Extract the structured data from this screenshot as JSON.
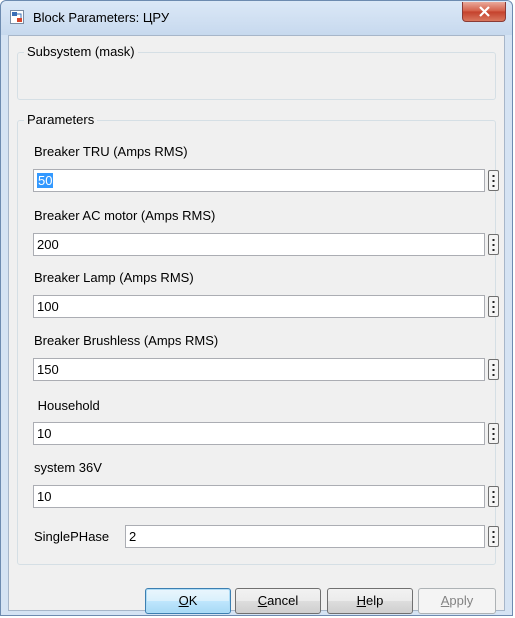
{
  "window": {
    "title": "Block Parameters: ЦРУ",
    "icon": "simulink-block-icon",
    "close_icon": "close-icon"
  },
  "mask_group": {
    "label": "Subsystem (mask)"
  },
  "params_group": {
    "label": "Parameters",
    "fields": [
      {
        "label": "Breaker  TRU (Amps RMS)",
        "value": "50"
      },
      {
        "label": "Breaker AC motor (Amps RMS)",
        "value": "200"
      },
      {
        "label": "Breaker Lamp (Amps RMS)",
        "value": "100"
      },
      {
        "label": "Breaker Brushless (Amps RMS)",
        "value": "150"
      },
      {
        "label": " Household",
        "value": "10"
      },
      {
        "label": "system 36V",
        "value": "10"
      }
    ],
    "inline_field": {
      "label": "SinglePHase",
      "value": "2"
    },
    "menu_icon": "vertical-ellipsis-icon"
  },
  "buttons": {
    "ok": {
      "label": "OK",
      "mnemonic": "O",
      "rest": "K"
    },
    "cancel": {
      "label": "Cancel",
      "mnemonic": "C",
      "rest": "ancel"
    },
    "help": {
      "label": "Help",
      "mnemonic": "H",
      "rest": "elp"
    },
    "apply": {
      "label": "Apply",
      "mnemonic": "A",
      "rest": "pply"
    }
  },
  "colors": {
    "selection": "#3399ff",
    "close_button": "#c4402b",
    "frame": "#d5e3f3"
  }
}
